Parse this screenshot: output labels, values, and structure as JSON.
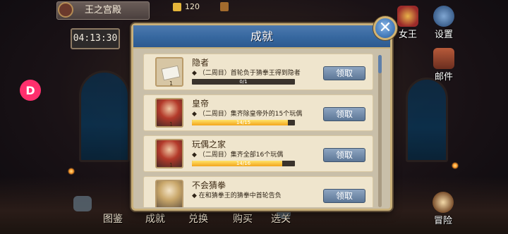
{
  "top_bar": {
    "palace_label": "王之宫殿",
    "coins": "120"
  },
  "timer": "04:13:30",
  "side_button_glyph": "D",
  "right_menu": [
    {
      "label": "女王",
      "icon": "crown-icon"
    },
    {
      "label": "设置",
      "icon": "gear-icon"
    },
    {
      "label": "邮件",
      "icon": "mail-chest-icon"
    },
    {
      "label": "冒险",
      "icon": "adventure-icon"
    }
  ],
  "bottom_nav": [
    {
      "label": "图鉴"
    },
    {
      "label": "成就"
    },
    {
      "label": "兑换"
    },
    {
      "label": "购买"
    },
    {
      "label": "选关"
    }
  ],
  "modal": {
    "title": "成就",
    "close_glyph": "✕",
    "achievements": [
      {
        "title": "隐者",
        "desc": "◆ （二周目）首轮负于猜拳王得到隐者",
        "progress": "0/1",
        "progress_fraction": 0.0,
        "level": "1",
        "button": "领取",
        "thumb": "paper"
      },
      {
        "title": "皇帝",
        "desc": "◆ （二周目）集齐除皇帝外的15个玩偶",
        "progress": "14/15",
        "progress_fraction": 0.93,
        "level": "1",
        "button": "领取",
        "thumb": "char"
      },
      {
        "title": "玩偶之家",
        "desc": "◆ （二周目）集齐全部16个玩偶",
        "progress": "14/16",
        "progress_fraction": 0.875,
        "level": "1",
        "button": "领取",
        "thumb": "char"
      },
      {
        "title": "不会猜拳",
        "desc": "◆ 在和猜拳王的猜拳中首轮告负",
        "progress": "",
        "progress_fraction": 0.0,
        "level": "",
        "button": "领取",
        "thumb": "char"
      }
    ]
  },
  "colors": {
    "modal_header": "#36679f",
    "panel_bg": "#c9bfa9",
    "row_bg": "#efe5cd",
    "progress_fill": "#f3a51a",
    "side_button": "#ff2f6d"
  }
}
